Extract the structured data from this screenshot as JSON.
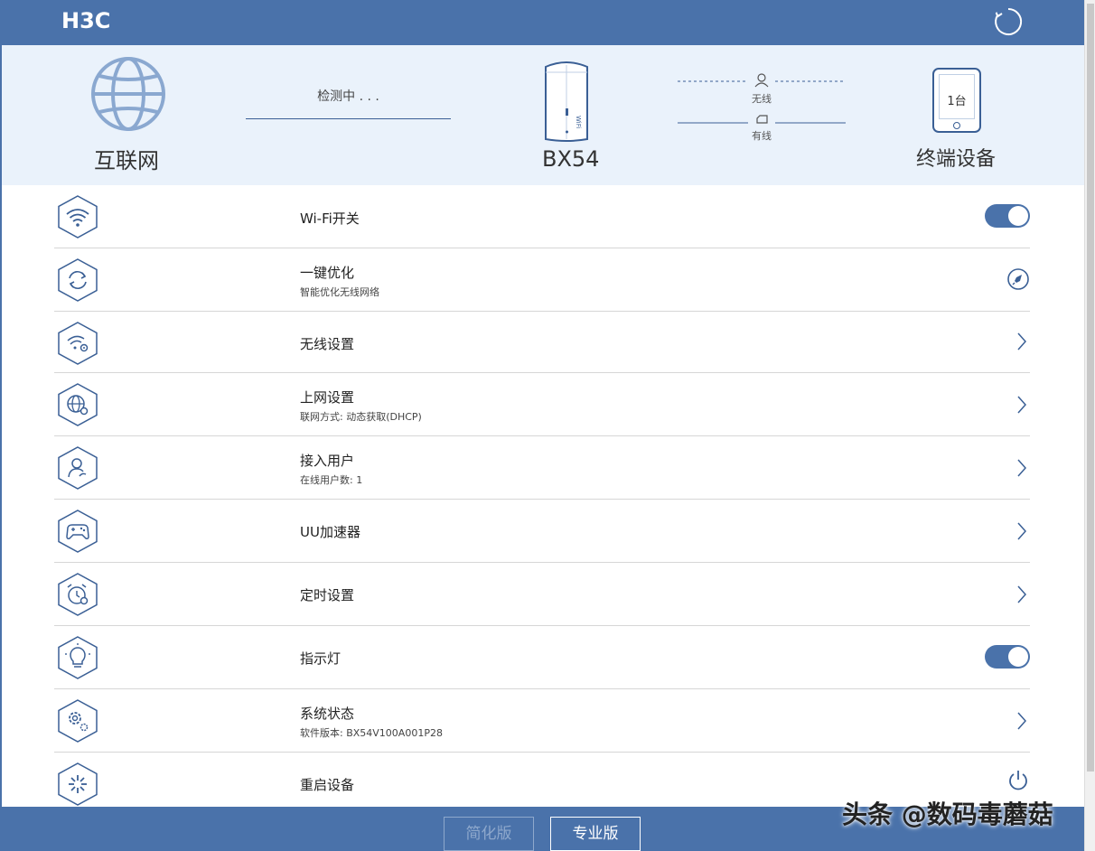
{
  "header": {
    "logo": "H3C",
    "refresh_icon": "refresh-icon"
  },
  "topology": {
    "internet_label": "互联网",
    "wan_status": "检测中 . . .",
    "device_name": "BX54",
    "device_badge": "WiFi",
    "wireless_label": "无线",
    "wired_label": "有线",
    "terminal_count": "1台",
    "terminal_label": "终端设备"
  },
  "menu": {
    "items": [
      {
        "title": "Wi-Fi开关",
        "sub": "",
        "icon": "wifi-icon",
        "right": "toggle-on"
      },
      {
        "title": "一键优化",
        "sub": "智能优化无线网络",
        "icon": "optimize-icon",
        "right": "rocket-icon"
      },
      {
        "title": "无线设置",
        "sub": "",
        "icon": "wifi-settings-icon",
        "right": "chevron"
      },
      {
        "title": "上网设置",
        "sub": "联网方式: 动态获取(DHCP)",
        "icon": "globe-settings-icon",
        "right": "chevron"
      },
      {
        "title": "接入用户",
        "sub": "在线用户数: 1",
        "icon": "user-icon",
        "right": "chevron"
      },
      {
        "title": "UU加速器",
        "sub": "",
        "icon": "gamepad-icon",
        "right": "chevron"
      },
      {
        "title": "定时设置",
        "sub": "",
        "icon": "alarm-icon",
        "right": "chevron"
      },
      {
        "title": "指示灯",
        "sub": "",
        "icon": "lightbulb-icon",
        "right": "toggle-on"
      },
      {
        "title": "系统状态",
        "sub": "软件版本: BX54V100A001P28",
        "icon": "system-gear-icon",
        "right": "chevron"
      },
      {
        "title": "重启设备",
        "sub": "",
        "icon": "restart-icon",
        "right": "power-icon"
      }
    ]
  },
  "footer": {
    "simple_label": "简化版",
    "pro_label": "专业版"
  },
  "watermark": "头条 @数码毒蘑菇",
  "colors": {
    "brand": "#4a72aa",
    "topology_bg": "#eaf2fb",
    "icon_stroke": "#3a5f95"
  }
}
